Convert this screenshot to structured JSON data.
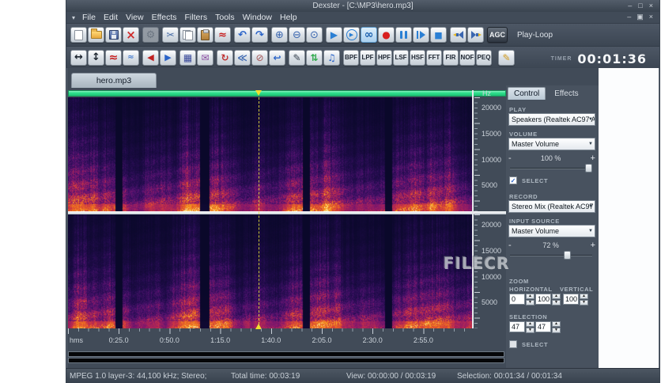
{
  "window": {
    "title": "Dexster - [C:\\MP3\\hero.mp3]",
    "controls": {
      "minimize": "–",
      "maximize": "□",
      "close": "×"
    },
    "child_controls": {
      "minimize": "–",
      "restore": "▣",
      "close": "×"
    }
  },
  "menu": {
    "items": [
      "File",
      "Edit",
      "View",
      "Effects",
      "Filters",
      "Tools",
      "Window",
      "Help"
    ]
  },
  "toolbar_main": {
    "groups": [
      [
        "new-file",
        "open-file",
        "save-file",
        "close-file"
      ],
      [
        "settings"
      ],
      [
        "cut",
        "copy",
        "paste",
        "draw-wave"
      ],
      [
        "undo",
        "redo"
      ],
      [
        "zoom-in",
        "zoom-out",
        "zoom-all"
      ],
      [
        "play",
        "play-selection",
        "loop",
        "record",
        "pause",
        "play-from-cursor",
        "stop"
      ],
      [
        "speaker-output",
        "speaker-input"
      ]
    ],
    "disabled": [
      "settings"
    ],
    "active": [
      "loop"
    ],
    "agc_label": "AGC",
    "mode_label": "Play-Loop"
  },
  "toolbar_edit": {
    "groups": [
      [
        "fit-horizontal",
        "fit-vertical",
        "waveform-red",
        "waveform-blue"
      ],
      [
        "fade-in",
        "fade-out"
      ],
      [
        "envelope",
        "send-mail"
      ],
      [
        "surround-pan",
        "echo",
        "noise-reduction",
        "reverse"
      ],
      [
        "id3-editor",
        "convert",
        "media-player"
      ]
    ],
    "filters": [
      "BPF",
      "LPF",
      "HPF",
      "LSF",
      "HSF",
      "FFT",
      "FIR",
      "NOF",
      "PEQ"
    ],
    "preset_button": "preset-editor",
    "timer_label": "TIMER",
    "timer_value": "00:01:36"
  },
  "document_tab": "hero.mp3",
  "sidebar": {
    "tabs": [
      {
        "label": "Control",
        "active": true
      },
      {
        "label": "Effects",
        "active": false
      }
    ],
    "play_label": "PLAY",
    "play_device": "Speakers (Realtek AC97 Au",
    "volume_label": "VOLUME",
    "volume_device": "Master Volume",
    "volume_percent": "100 %",
    "volume_value": 100,
    "select_playback_label": "SELECT",
    "select_playback_checked": true,
    "record_label": "RECORD",
    "record_device": "Stereo Mix (Realtek AC97 A",
    "input_source_label": "INPUT SOURCE",
    "input_source_device": "Master Volume",
    "record_percent": "72 %",
    "record_value": 72,
    "zoom_label": "ZOOM",
    "horizontal_label": "HORIZONTAL",
    "vertical_label": "VERTICAL",
    "zoom_h_start": "0",
    "zoom_h_end": "100",
    "zoom_v": "100",
    "selection_label": "SELECTION",
    "selection_start": "47",
    "selection_end": "47",
    "select_selection_label": "SELECT",
    "select_selection_checked": false,
    "minus": "-",
    "plus": "+"
  },
  "time_ruler": {
    "unit": "hms",
    "labels": [
      {
        "text": "0:25.0",
        "pct": 12.56
      },
      {
        "text": "0:50.0",
        "pct": 25.13
      },
      {
        "text": "1:15.0",
        "pct": 37.69
      },
      {
        "text": "1:40.0",
        "pct": 50.25
      },
      {
        "text": "2:05.0",
        "pct": 62.81
      },
      {
        "text": "2:30.0",
        "pct": 75.38
      },
      {
        "text": "2:55.0",
        "pct": 87.94
      }
    ]
  },
  "freq_ruler": {
    "unit": "Hz",
    "labels": [
      {
        "text": "20000",
        "pct": 9.3
      },
      {
        "text": "15000",
        "pct": 32.0
      },
      {
        "text": "10000",
        "pct": 54.6
      },
      {
        "text": "5000",
        "pct": 77.3
      }
    ]
  },
  "spectrogram": {
    "channels": 2,
    "playhead_pct": 47.24,
    "silence_gaps_pct": [
      [
        11.8,
        13.4
      ],
      [
        32.7,
        35.0
      ],
      [
        58.2,
        59.8
      ],
      [
        78.6,
        80.2
      ]
    ]
  },
  "status_bar": {
    "format": "MPEG 1.0 layer-3: 44,100 kHz; Stereo;",
    "total_time": "Total time: 00:03:19",
    "view": "View: 00:00:00 / 00:03:19",
    "selection": "Selection: 00:01:34 / 00:01:34"
  },
  "watermark": "FILECR",
  "colors": {
    "position_bar": "#2ee08c",
    "playhead": "#f0df2e",
    "spect_background": "#0a082a",
    "spect_peak": "#fcf0a0",
    "titlebar": "#414b58",
    "sidebar_bg": "#48525f"
  }
}
